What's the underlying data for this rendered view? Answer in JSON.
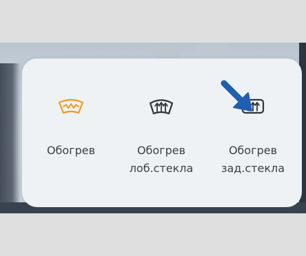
{
  "controls": [
    {
      "label_line1": "Обогрев",
      "label_line2": "",
      "icon": "windshield-heater-icon",
      "state": "active"
    },
    {
      "label_line1": "Обогрев",
      "label_line2": "лоб.стекла",
      "icon": "front-defrost-icon",
      "state": "inactive"
    },
    {
      "label_line1": "Обогрев",
      "label_line2": "зад.стекла",
      "icon": "rear-defrost-icon",
      "state": "inactive"
    }
  ],
  "colors": {
    "active": "#f39a1c",
    "inactive": "#30343a",
    "arrow": "#1f5fb0",
    "text": "#3b3f46",
    "panel": "#eef2f5"
  },
  "annotation": {
    "type": "arrow",
    "points_to": "rear-defrost-button"
  }
}
